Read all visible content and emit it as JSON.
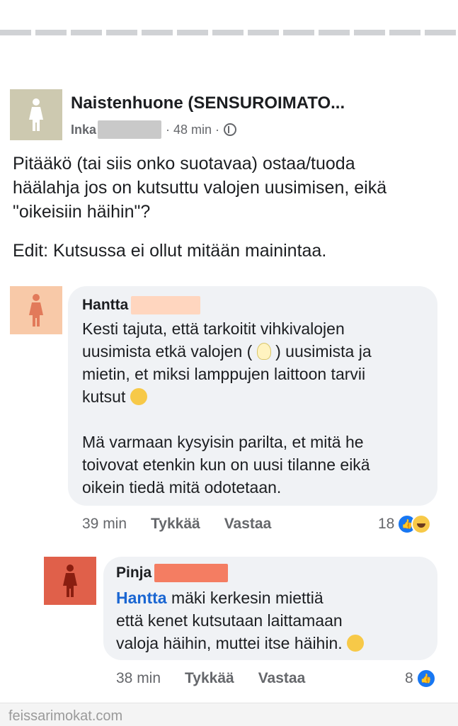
{
  "post": {
    "group_name": "Naistenhuone (SENSUROIMATO...",
    "author": "Inka",
    "time": "· 48 min ·",
    "text_lines": [
      "Pitääkö (tai siis onko suotavaa) ostaa/tuoda",
      "häälahja jos on kutsuttu valojen uusimisen, eikä",
      "\"oikeisiin häihin\"?"
    ],
    "edit": "Edit: Kutsussa ei ollut mitään mainintaa."
  },
  "comments": [
    {
      "name": "Hantta",
      "lines": [
        "Kesti tajuta, että tarkoitit vihkivalojen",
        "uusimista etkä valojen (",
        ") uusimista ja",
        "mietin, et miksi lamppujen laittoon tarvii",
        "kutsut"
      ],
      "lines2": [
        "Mä varmaan kysyisin parilta, et mitä he",
        "toivovat etenkin kun on uusi tilanne eikä",
        "oikein tiedä mitä odotetaan."
      ],
      "time": "39 min",
      "like": "Tykkää",
      "reply": "Vastaa",
      "reactions": "18",
      "avatar_color": "#f8c9a8"
    },
    {
      "name": "Pinja",
      "mention": "Hantta",
      "lines": [
        "mäki kerkesin miettiä",
        "että kenet kutsutaan laittamaan",
        "valoja häihin, muttei itse häihin."
      ],
      "time": "38 min",
      "like": "Tykkää",
      "reply": "Vastaa",
      "reactions": "8",
      "avatar_color": "#e0604a"
    }
  ],
  "watermark": "feissarimokat.com",
  "colors": {
    "group_avatar": "#cdc9b0",
    "mention": "#1a66d2",
    "like_badge": "#1877f2"
  }
}
